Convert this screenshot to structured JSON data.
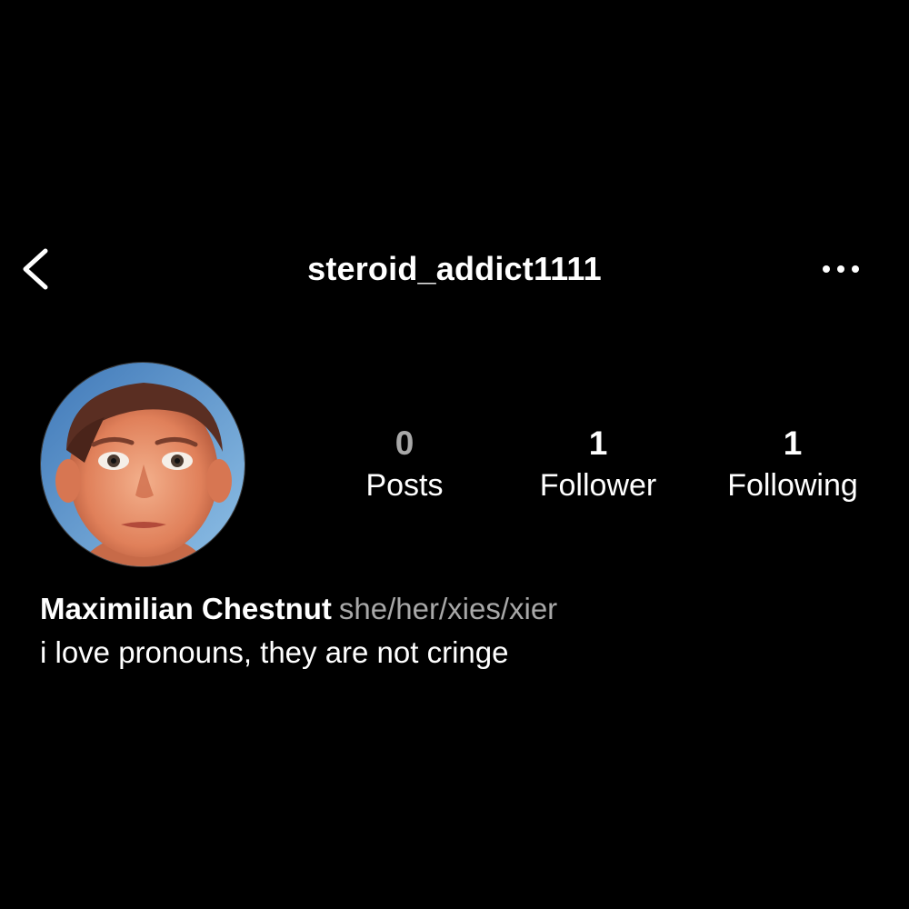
{
  "header": {
    "username": "steroid_addict1111",
    "back_icon": "chevron-left-icon",
    "more_icon": "more-horizontal-icon"
  },
  "profile": {
    "avatar_icon": "profile-photo",
    "stats": {
      "posts": {
        "count": "0",
        "label": "Posts"
      },
      "followers": {
        "count": "1",
        "label": "Follower"
      },
      "following": {
        "count": "1",
        "label": "Following"
      }
    },
    "display_name": "Maximilian Chestnut",
    "pronouns": "she/her/xies/xier",
    "bio": "i love pronouns, they are not cringe"
  },
  "colors": {
    "background": "#000000",
    "text_primary": "#ffffff",
    "text_secondary": "#a8a8a8"
  }
}
